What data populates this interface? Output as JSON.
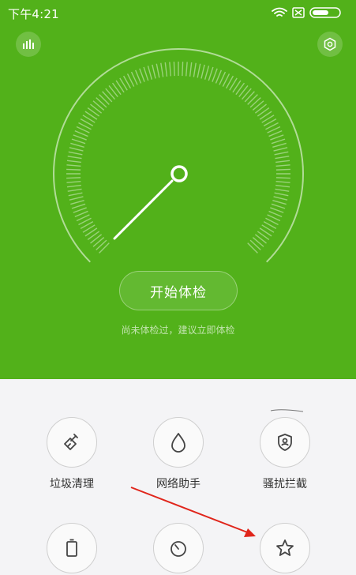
{
  "status": {
    "time": "下午4:21"
  },
  "gauge": {
    "button_label": "开始体检",
    "hint": "尚未体检过，建议立即体检"
  },
  "tools": [
    {
      "label": "垃圾清理",
      "icon": "broom-icon"
    },
    {
      "label": "网络助手",
      "icon": "droplet-icon"
    },
    {
      "label": "骚扰拦截",
      "icon": "shield-user-icon"
    },
    {
      "label": "",
      "icon": "battery-icon"
    },
    {
      "label": "",
      "icon": "timer-icon"
    },
    {
      "label": "",
      "icon": "star-icon"
    }
  ],
  "colors": {
    "header_green": "#52b11a",
    "arrow_red": "#e0251b"
  }
}
